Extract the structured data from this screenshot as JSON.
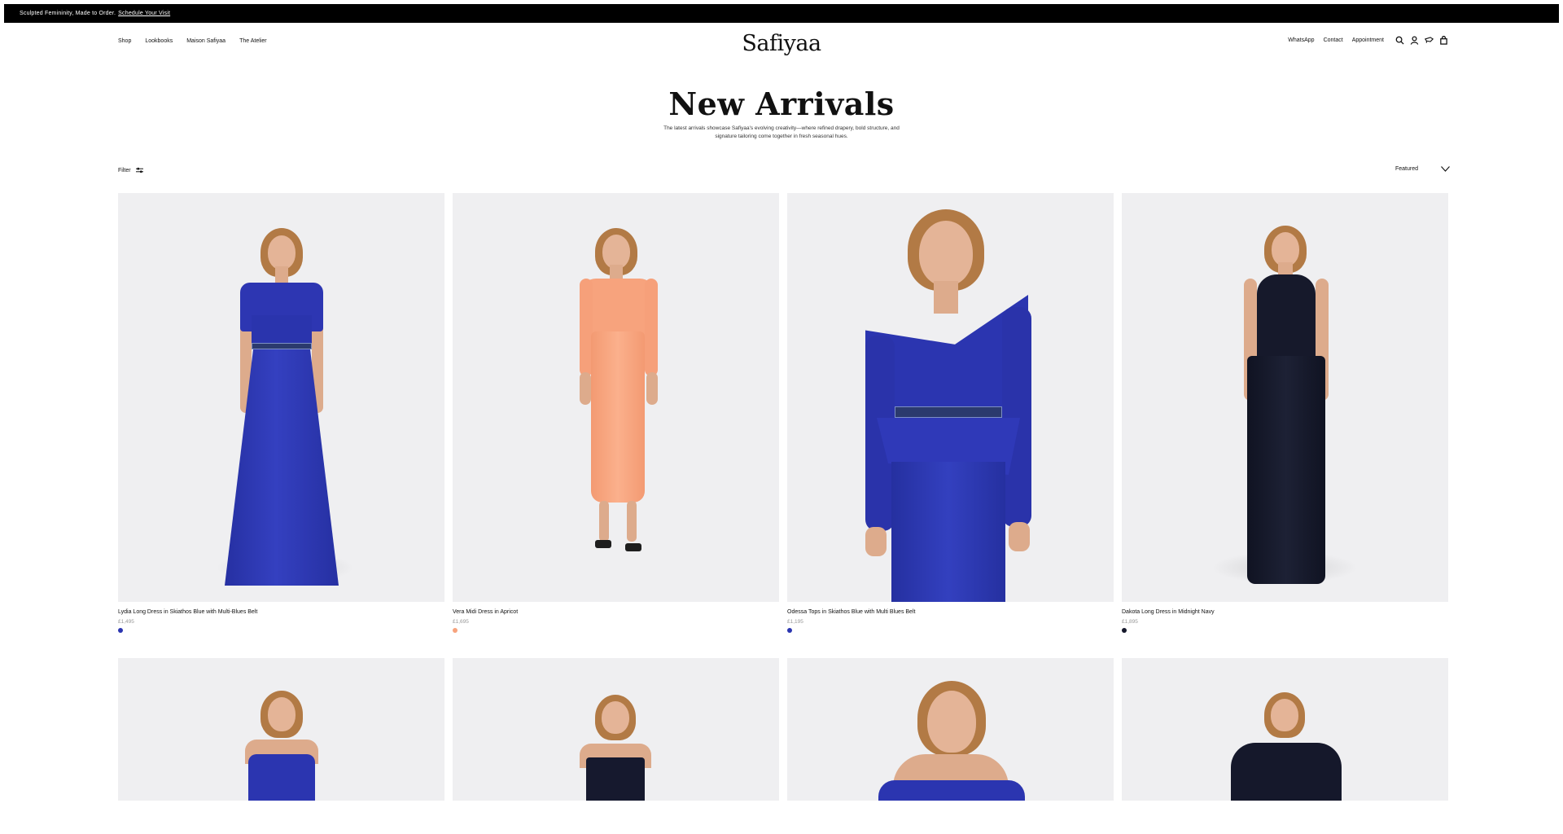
{
  "announcement": {
    "text": "Sculpted Femininity, Made to Order.",
    "link": "Schedule Your Visit"
  },
  "nav": {
    "left": [
      "Shop",
      "Lookbooks",
      "Maison Safiyaa",
      "The Atelier"
    ],
    "logo": "Safiyaa",
    "right": [
      "WhatsApp",
      "Contact",
      "Appointment"
    ],
    "icons": [
      "search-icon",
      "account-icon",
      "wishlist-icon",
      "bag-icon"
    ]
  },
  "page": {
    "title": "New Arrivals",
    "intro": "The latest arrivals showcase Safiyaa's evolving creativity—where refined drapery, bold structure, and signature tailoring come together in fresh seasonal hues."
  },
  "toolbar": {
    "filter_label": "Filter",
    "sort_label": "Featured"
  },
  "colors": {
    "skiathos_blue": "#2b35b0",
    "apricot": "#f7a37d",
    "midnight_navy": "#15182b",
    "card_bg": "#efeff1"
  },
  "products": [
    {
      "name": "Lydia Long Dress in Skiathos Blue with Multi-Blues Belt",
      "price": "£1,495",
      "swatch": "#2b35b0"
    },
    {
      "name": "Vera Midi Dress in Apricot",
      "price": "£1,695",
      "swatch": "#f7a37d"
    },
    {
      "name": "Odessa Tops in Skiathos Blue with Multi Blues Belt",
      "price": "£1,195",
      "swatch": "#2b35b0"
    },
    {
      "name": "Dakota Long Dress in Midnight Navy",
      "price": "£1,895",
      "swatch": "#15182b"
    }
  ]
}
